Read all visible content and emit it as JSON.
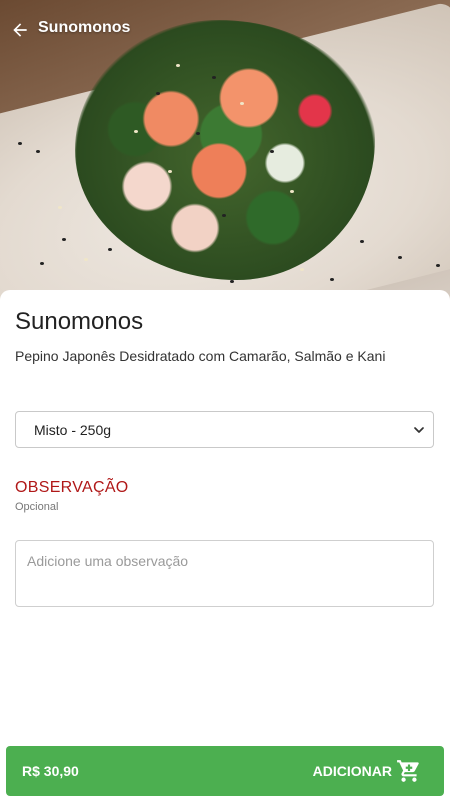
{
  "header": {
    "title": "Sunomonos",
    "back_icon": "arrow-left-icon"
  },
  "product": {
    "name": "Sunomonos",
    "description": "Pepino Japonês Desidratado com Camarão, Salmão e Kani"
  },
  "variant_select": {
    "selected": "Misto - 250g",
    "icon": "chevron-down-icon"
  },
  "observation": {
    "title": "OBSERVAÇÃO",
    "subtitle": "Opcional",
    "placeholder": "Adicione uma observação"
  },
  "cart_bar": {
    "price": "R$ 30,90",
    "add_label": "ADICIONAR",
    "icon": "cart-icon",
    "color": "#4caf50"
  },
  "colors": {
    "observation_title": "#b01818"
  }
}
